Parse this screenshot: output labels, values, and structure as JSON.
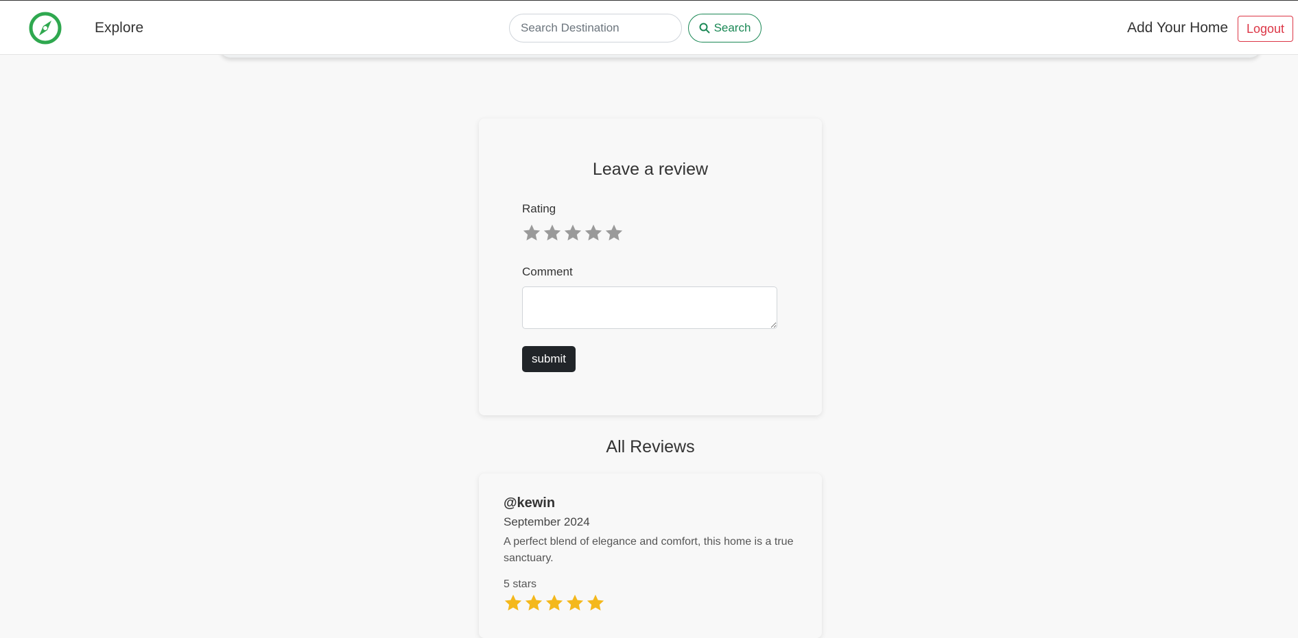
{
  "nav": {
    "explore_label": "Explore",
    "search_placeholder": "Search Destination",
    "search_button_label": "Search",
    "add_home_label": "Add Your Home",
    "logout_label": "Logout",
    "logo_icon": "compass-icon",
    "brand_color": "#2fa84f"
  },
  "review_form": {
    "title": "Leave a review",
    "rating_label": "Rating",
    "rating_value": 0,
    "rating_max": 5,
    "comment_label": "Comment",
    "comment_value": "",
    "submit_label": "submit",
    "star_empty_color": "#9a9a9a"
  },
  "reviews_section": {
    "title": "All Reviews",
    "reviews": [
      {
        "author": "@kewin",
        "date": "September 2024",
        "comment": "A perfect blend of elegance and comfort, this home is a true sanctuary.",
        "rating_text": "5 stars",
        "rating": 5,
        "star_color": "#f4b81c"
      }
    ]
  }
}
